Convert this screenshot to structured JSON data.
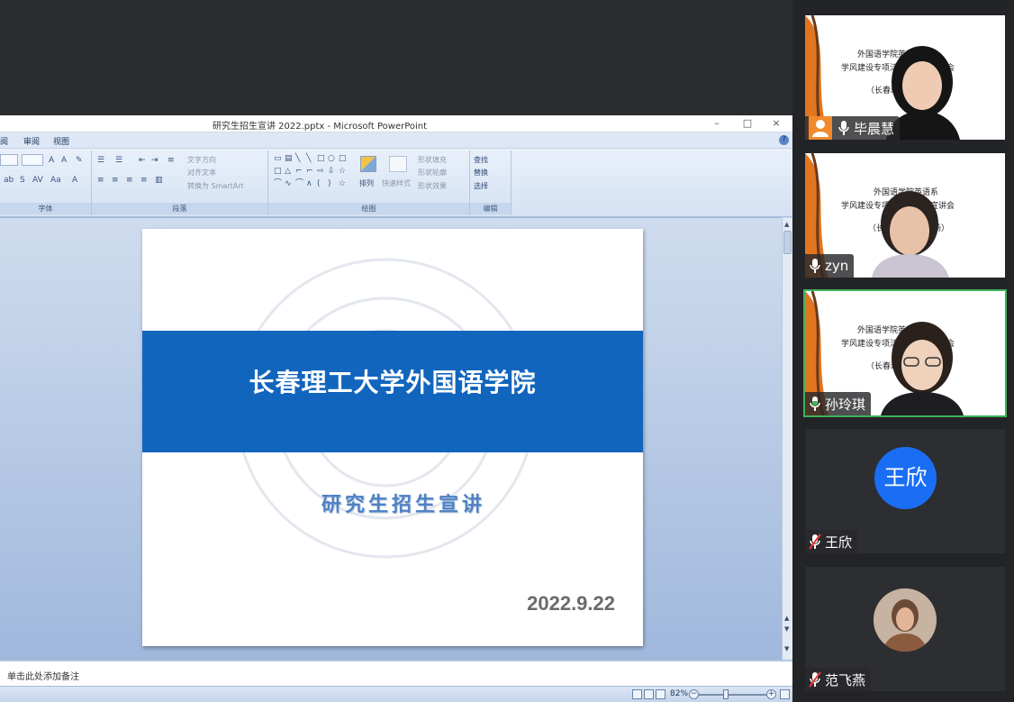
{
  "window": {
    "title": "研究生招生宣讲 2022.pptx - Microsoft PowerPoint",
    "minimize": "–",
    "maximize": "□",
    "close": "×"
  },
  "menu": [
    "阅",
    "审阅",
    "视图"
  ],
  "ribbon": {
    "font_group": "字体",
    "paragraph_group": "段落",
    "drawing_group": "绘图",
    "editing_group": "编辑",
    "text_direction": "文字方向",
    "align_text": "对齐文本",
    "convert_smartart": "转换为 SmartArt",
    "arrange": "排列",
    "quick_styles": "快速样式",
    "shape_fill": "形状填充",
    "shape_outline": "形状轮廓",
    "shape_effects": "形状效果",
    "find": "查找",
    "replace": "替换",
    "select": "选择"
  },
  "slide": {
    "school": "长春理工大学外国语学院",
    "subtitle": "研究生招生宣讲",
    "date": "2022.9.22"
  },
  "notes": {
    "placeholder": "单击此处添加备注"
  },
  "status": {
    "zoom": "82%"
  },
  "participants": [
    {
      "name": "毕晨慧",
      "type": "camera",
      "host": true,
      "muted": false,
      "bg_line1": "外国语学院英语系",
      "bg_line2": "学风建设专项活动暨考研宣讲会",
      "bg_line3": "（长春理工大学专场）"
    },
    {
      "name": "zyn",
      "type": "camera",
      "host": false,
      "muted": false,
      "bg_line1": "外国语学院英语系",
      "bg_line2": "学风建设专项活动暨考研宣讲会",
      "bg_line3": "（长春理工大学专场）"
    },
    {
      "name": "孙玲琪",
      "type": "camera",
      "host": false,
      "muted": false,
      "speaking": true,
      "bg_line1": "外国语学院英语系",
      "bg_line2": "学风建设专项活动暨考研宣讲会",
      "bg_line3": "（长春理工大学专场）"
    },
    {
      "name": "王欣",
      "type": "avatar",
      "avatar_text": "王欣",
      "avatar_color": "#1a6ef4",
      "muted": true
    },
    {
      "name": "范飞燕",
      "type": "photo",
      "muted": true
    }
  ]
}
